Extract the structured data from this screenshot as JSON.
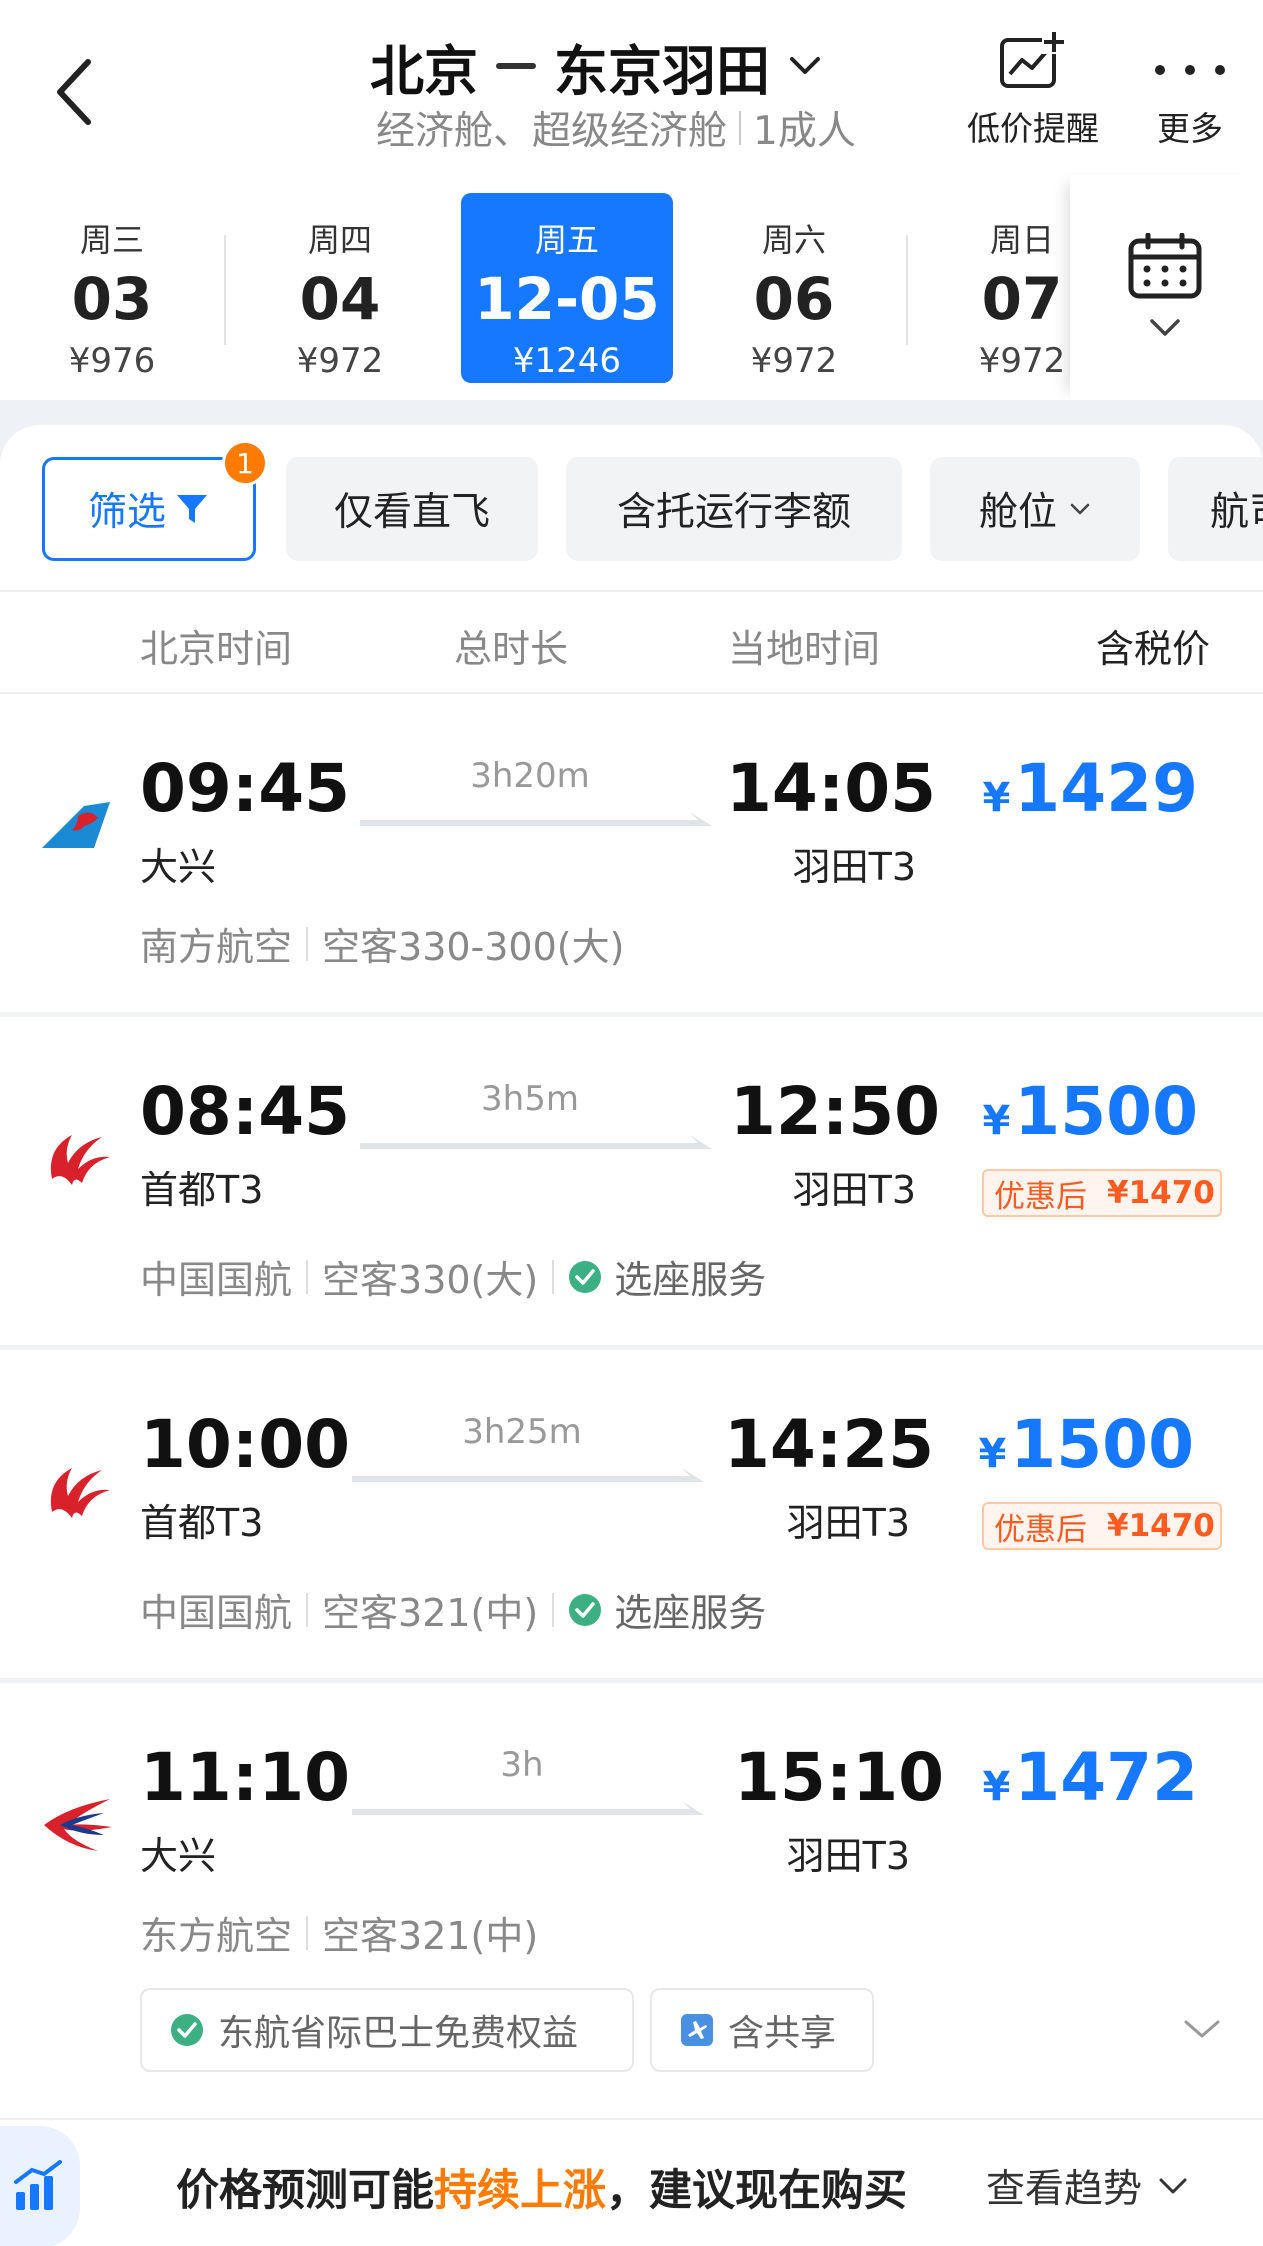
{
  "header": {
    "origin": "北京",
    "destination": "东京羽田",
    "cabin": "经济舱、超级经济舱",
    "passengers": "1成人",
    "price_alert_label": "低价提醒",
    "more_label": "更多"
  },
  "dates": [
    {
      "weekday": "周三",
      "day": "03",
      "price": "¥976",
      "selected": false
    },
    {
      "weekday": "周四",
      "day": "04",
      "price": "¥972",
      "selected": false
    },
    {
      "weekday": "周五",
      "day": "12-05",
      "price": "¥1246",
      "selected": true
    },
    {
      "weekday": "周六",
      "day": "06",
      "price": "¥972",
      "selected": false
    },
    {
      "weekday": "周日",
      "day": "07",
      "price": "¥972",
      "selected": false
    }
  ],
  "filters": {
    "filter_label": "筛选",
    "filter_badge": "1",
    "chips": [
      "仅看直飞",
      "含托运行李额",
      "舱位",
      "航司"
    ]
  },
  "columns": {
    "beijing_time": "北京时间",
    "duration": "总时长",
    "local_time": "当地时间",
    "tax_price": "含税价"
  },
  "flights": [
    {
      "airline_logo": "china-southern-logo",
      "dep_time": "09:45",
      "dep_airport": "大兴",
      "duration": "3h20m",
      "arr_time": "14:05",
      "arr_airport": "羽田T3",
      "currency": "¥",
      "price": "1429",
      "airline": "南方航空",
      "aircraft": "空客330-300(大)"
    },
    {
      "airline_logo": "air-china-logo",
      "dep_time": "08:45",
      "dep_airport": "首都T3",
      "duration": "3h5m",
      "arr_time": "12:50",
      "arr_airport": "羽田T3",
      "currency": "¥",
      "price": "1500",
      "discount_label": "优惠后",
      "discount_price": "¥1470",
      "airline": "中国国航",
      "aircraft": "空客330(大)",
      "service": "选座服务"
    },
    {
      "airline_logo": "air-china-logo",
      "dep_time": "10:00",
      "dep_airport": "首都T3",
      "duration": "3h25m",
      "arr_time": "14:25",
      "arr_airport": "羽田T3",
      "currency": "¥",
      "price": "1500",
      "discount_label": "优惠后",
      "discount_price": "¥1470",
      "airline": "中国国航",
      "aircraft": "空客321(中)",
      "service": "选座服务"
    },
    {
      "airline_logo": "china-eastern-logo",
      "dep_time": "11:10",
      "dep_airport": "大兴",
      "duration": "3h",
      "arr_time": "15:10",
      "arr_airport": "羽田T3",
      "currency": "¥",
      "price": "1472",
      "airline": "东方航空",
      "aircraft": "空客321(中)",
      "tags": [
        "东航省际巴士免费权益",
        "含共享"
      ]
    }
  ],
  "bottom": {
    "tip_prefix": "价格预测可能",
    "tip_highlight": "持续上涨",
    "tip_suffix": "，建议现在购买",
    "trend_label": "查看趋势"
  },
  "colors": {
    "accent": "#1677ff",
    "orange": "#ff7a00",
    "discount": "#ff5a1f",
    "check_green": "#3db083"
  }
}
